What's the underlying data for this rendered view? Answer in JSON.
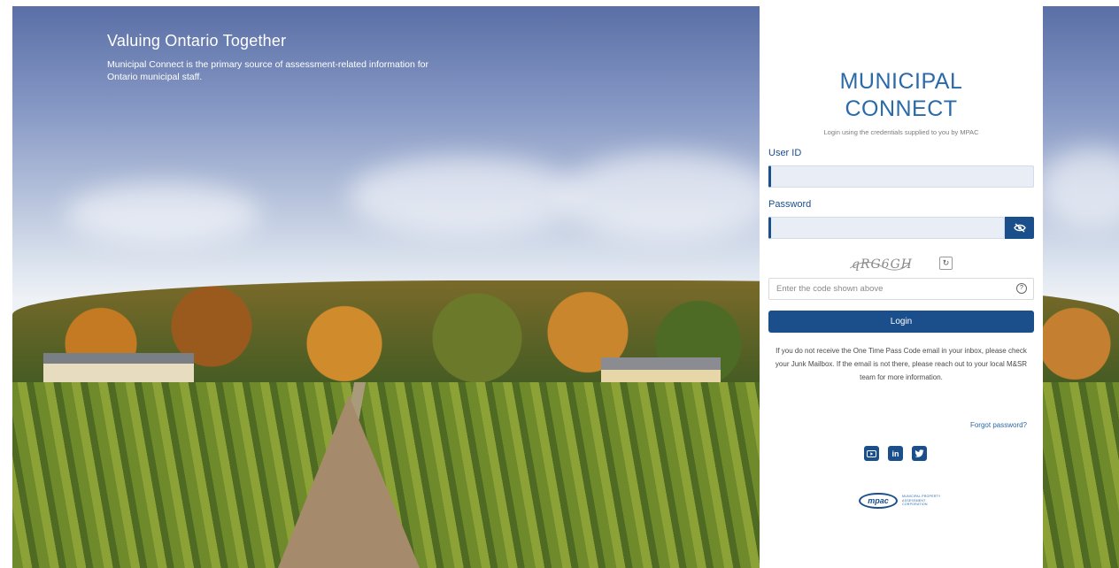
{
  "tagline": {
    "title": "Valuing Ontario Together",
    "text": "Municipal Connect is the primary source of assessment-related information for Ontario municipal staff."
  },
  "login": {
    "brand_line1": "MUNICIPAL",
    "brand_line2": "CONNECT",
    "subtitle": "Login using the credentials supplied to you by MPAC",
    "user_id_label": "User ID",
    "user_id_value": "",
    "password_label": "Password",
    "password_value": "",
    "captcha_text": "qRG6GH",
    "code_placeholder": "Enter the code shown above",
    "login_label": "Login",
    "notice": "If you do not receive the One Time Pass Code email in your inbox, please check your Junk Mailbox. If the email is not there, please reach out to your local M&SR team for more information.",
    "forgot_label": "Forgot password?"
  },
  "social": {
    "youtube": "youtube-icon",
    "linkedin": "linkedin-icon",
    "twitter": "twitter-icon"
  },
  "footer": {
    "logo_text": "mpac",
    "org_name": "MUNICIPAL PROPERTY ASSESSMENT CORPORATION"
  },
  "colors": {
    "primary": "#1a4f8c",
    "brand": "#2a6aa8"
  }
}
